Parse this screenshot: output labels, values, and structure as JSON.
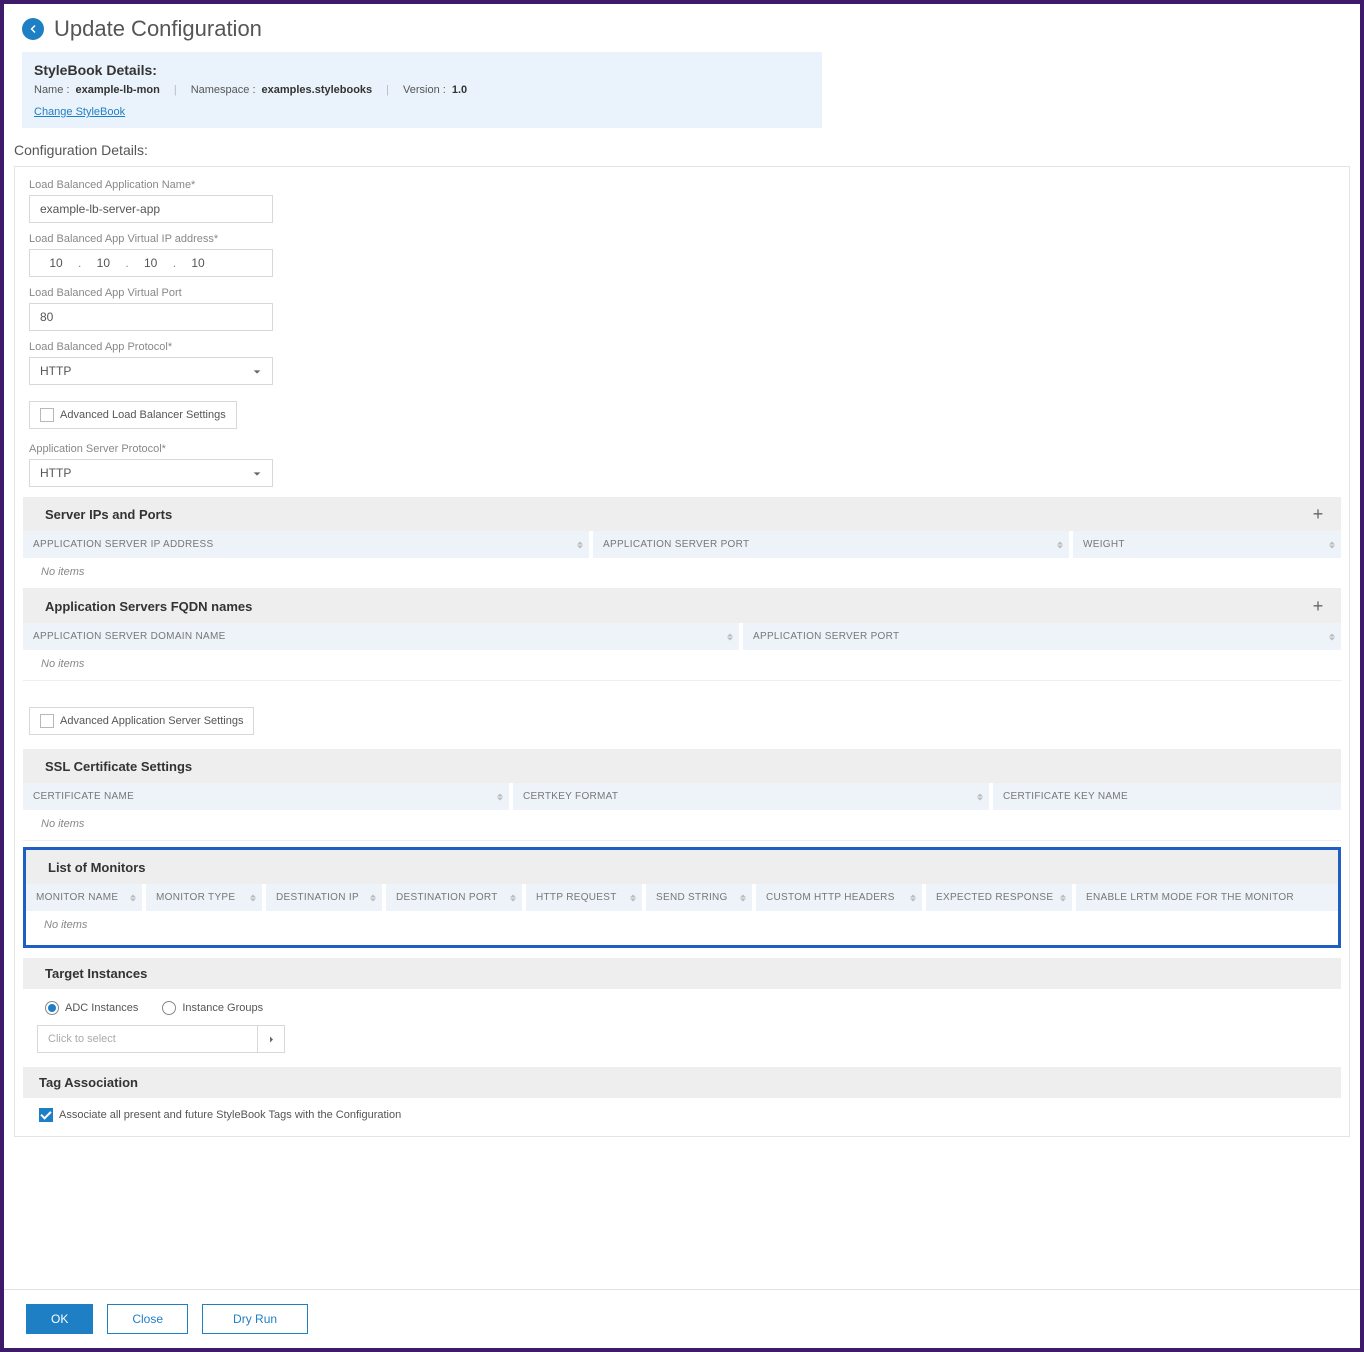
{
  "header": {
    "title": "Update Configuration"
  },
  "stylebook": {
    "box_title": "StyleBook Details:",
    "name_label": "Name :",
    "name_value": "example-lb-mon",
    "namespace_label": "Namespace :",
    "namespace_value": "examples.stylebooks",
    "version_label": "Version :",
    "version_value": "1.0",
    "change_link": "Change StyleBook"
  },
  "config_details_title": "Configuration Details:",
  "fields": {
    "app_name_label": "Load Balanced Application Name*",
    "app_name_value": "example-lb-server-app",
    "vip_label": "Load Balanced App Virtual IP address*",
    "vip_octets": [
      "10",
      "10",
      "10",
      "10"
    ],
    "vport_label": "Load Balanced App Virtual Port",
    "vport_value": "80",
    "protocol_label": "Load Balanced App Protocol*",
    "protocol_value": "HTTP",
    "adv_lb_label": "Advanced Load Balancer Settings",
    "server_protocol_label": "Application Server Protocol*",
    "server_protocol_value": "HTTP"
  },
  "server_ips": {
    "title": "Server IPs and Ports",
    "cols": [
      "APPLICATION SERVER IP ADDRESS",
      "APPLICATION SERVER PORT",
      "WEIGHT"
    ],
    "empty": "No items"
  },
  "fqdn": {
    "title": "Application Servers FQDN names",
    "cols": [
      "APPLICATION SERVER DOMAIN NAME",
      "APPLICATION SERVER PORT"
    ],
    "empty": "No items"
  },
  "adv_app_label": "Advanced Application Server Settings",
  "ssl": {
    "title": "SSL Certificate Settings",
    "cols": [
      "CERTIFICATE NAME",
      "CERTKEY FORMAT",
      "CERTIFICATE KEY NAME"
    ],
    "empty": "No items"
  },
  "monitors": {
    "title": "List of Monitors",
    "cols": [
      "MONITOR NAME",
      "MONITOR TYPE",
      "DESTINATION IP",
      "DESTINATION PORT",
      "HTTP REQUEST",
      "SEND STRING",
      "CUSTOM HTTP HEADERS",
      "EXPECTED RESPONSE",
      "ENABLE LRTM MODE FOR THE MONITOR"
    ],
    "empty": "No items"
  },
  "target": {
    "title": "Target Instances",
    "radio_adc": "ADC Instances",
    "radio_groups": "Instance Groups",
    "click_placeholder": "Click to select"
  },
  "tag": {
    "title": "Tag Association",
    "assoc_label": "Associate all present and future StyleBook Tags with the Configuration"
  },
  "footer": {
    "ok": "OK",
    "close": "Close",
    "dryrun": "Dry Run"
  }
}
